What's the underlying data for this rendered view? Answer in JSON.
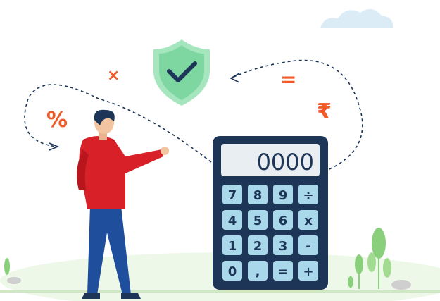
{
  "scene": {
    "floating_symbols": {
      "times": "×",
      "percent": "%",
      "equals": "=",
      "rupee": "₹"
    },
    "calculator": {
      "display": "0000",
      "keys": [
        [
          "7",
          "8",
          "9",
          "÷"
        ],
        [
          "4",
          "5",
          "6",
          "x"
        ],
        [
          "1",
          "2",
          "3",
          "-"
        ],
        [
          "0",
          ",",
          "=",
          "+"
        ]
      ]
    },
    "colors": {
      "accent_orange": "#f05a28",
      "calculator_body": "#1d3557",
      "key_face": "#a8d8ea",
      "display_face": "#e9eef2",
      "shield_green": "#7ed6a0",
      "shirt_red": "#d72027",
      "pants_blue": "#1f4e9c",
      "plant_green": "#8ad07c"
    },
    "icons": [
      "shield-check-icon",
      "cloud-icon",
      "person-illustration",
      "plant-icon"
    ]
  }
}
